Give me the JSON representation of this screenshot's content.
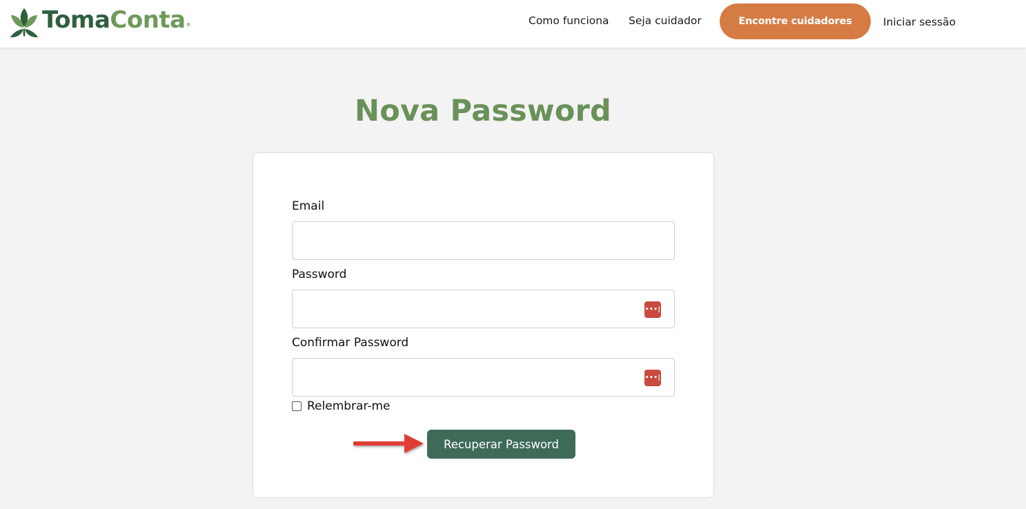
{
  "header": {
    "logo": {
      "part1": "Toma",
      "part2": "Conta",
      "reg": "®"
    },
    "nav": {
      "como_funciona": "Como funciona",
      "seja_cuidador": "Seja cuidador",
      "cta": "Encontre cuidadores",
      "login": "Iniciar sessão"
    }
  },
  "main": {
    "title": "Nova Password",
    "form": {
      "email_label": "Email",
      "email_value": "",
      "password_label": "Password",
      "password_value": "",
      "confirm_label": "Confirmar Password",
      "confirm_value": "",
      "remember_label": "Relembrar-me",
      "remember_checked": false,
      "password_icon": "•••|",
      "submit_label": "Recuperar Password"
    }
  },
  "colors": {
    "brand_dark_green": "#2f5f3f",
    "brand_light_green": "#6f9a5a",
    "title_green": "#6a9159",
    "cta_orange": "#d57c45",
    "submit_green": "#3e6b58",
    "password_icon_red": "#c94a3f",
    "annotation_arrow_red": "#e03c36"
  },
  "icons": {
    "logo": "leaf-logo-icon",
    "password_manager": "password-manager-icon",
    "annotation": "red-arrow-icon"
  }
}
